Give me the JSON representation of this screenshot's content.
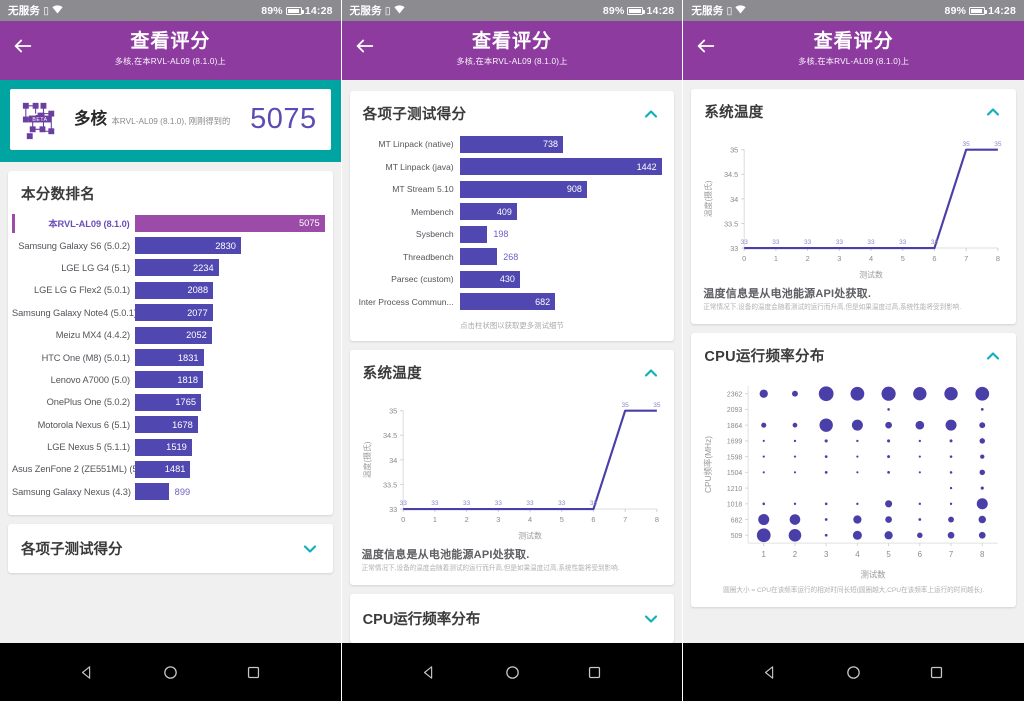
{
  "status_bar": {
    "carrier": "无服务",
    "battery_percent": "89%",
    "time": "14:28",
    "icons": [
      "sim-icon",
      "wifi-icon",
      "battery-icon"
    ]
  },
  "app_bar": {
    "title": "查看评分",
    "subtitle": "多核,在本RVL-AL09 (8.1.0)上",
    "back_icon": "back-arrow-icon"
  },
  "hero": {
    "logo": "geekbench-beta-logo",
    "title": "多核",
    "subtitle": "本RVL-AL09 (8.1.0), 刚刚得到的",
    "score": "5075"
  },
  "sections": {
    "ranking_title": "本分数排名",
    "subtest_title": "各项子测试得分",
    "temperature_title": "系统温度",
    "cpu_freq_title": "CPU运行频率分布",
    "subtest_hint": "点击柱状图以获取更多测试细节",
    "temp_note_main": "温度信息是从电池能源API处获取.",
    "temp_note_sub": "正常情况下,设备的温度会随着测试的运行而升高,但是如果温度过高,系统性能将受到影响.",
    "cpu_note": "圆圈大小 = CPU在该频率运行的相对时间长短(圆圈越大,CPU在该频率上运行的时间越长)."
  },
  "chart_data": [
    {
      "type": "bar",
      "title": "本分数排名",
      "orientation": "horizontal",
      "highlight_index": 0,
      "categories": [
        "本RVL-AL09 (8.1.0)",
        "Samsung Galaxy S6 (5.0.2)",
        "LGE LG G4 (5.1)",
        "LGE LG G Flex2 (5.0.1)",
        "Samsung Galaxy Note4 (5.0.1)",
        "Meizu MX4 (4.4.2)",
        "HTC One (M8) (5.0.1)",
        "Lenovo A7000 (5.0)",
        "OnePlus One (5.0.2)",
        "Motorola Nexus 6 (5.1)",
        "LGE Nexus 5 (5.1.1)",
        "Asus ZenFone 2 (ZE551ML) (5...",
        "Samsung Galaxy Nexus (4.3)"
      ],
      "values": [
        5075,
        2830,
        2234,
        2088,
        2077,
        2052,
        1831,
        1818,
        1765,
        1678,
        1519,
        1481,
        899
      ],
      "xlabel": "",
      "ylabel": "",
      "xlim": [
        0,
        5075
      ]
    },
    {
      "type": "bar",
      "title": "各项子测试得分",
      "orientation": "horizontal",
      "categories": [
        "MT Linpack (native)",
        "MT Linpack (java)",
        "MT Stream 5.10",
        "Membench",
        "Sysbench",
        "Threadbench",
        "Parsec (custom)",
        "Inter Process Commun..."
      ],
      "values": [
        738,
        1442,
        908,
        409,
        198,
        268,
        430,
        682
      ],
      "xlabel": "",
      "ylabel": "",
      "xlim": [
        0,
        1442
      ]
    },
    {
      "type": "line",
      "title": "系统温度",
      "x": [
        0,
        1,
        2,
        3,
        4,
        5,
        6,
        7,
        8
      ],
      "values": [
        33,
        33,
        33,
        33,
        33,
        33,
        33,
        35,
        35
      ],
      "point_labels": [
        "33",
        "33",
        "33",
        "33",
        "33",
        "33",
        "33",
        "35",
        "35"
      ],
      "xlabel": "测试数",
      "ylabel": "温度(摄氏)",
      "ytick_labels": [
        "33",
        "33.5",
        "34",
        "34.5",
        "35"
      ],
      "xtick_labels": [
        "0",
        "1",
        "2",
        "3",
        "4",
        "5",
        "6",
        "7",
        "8"
      ],
      "ylim": [
        33,
        35
      ],
      "xlim": [
        0,
        8
      ],
      "grid": false,
      "legend": "none",
      "line_color": "#4a3fa8"
    },
    {
      "type": "scatter",
      "title": "CPU运行频率分布",
      "xlabel": "测试数",
      "ylabel": "CPU频率(MHz)",
      "xtick_labels": [
        "1",
        "2",
        "3",
        "4",
        "5",
        "6",
        "7",
        "8"
      ],
      "ytick_labels": [
        "2362",
        "2093",
        "1864",
        "1699",
        "1598",
        "1504",
        "1210",
        "1018",
        "682",
        "509"
      ],
      "bubble_color": "#4a3fa8",
      "points": [
        {
          "x": 1,
          "y": "2362",
          "r": 4.2
        },
        {
          "x": 2,
          "y": "2362",
          "r": 3.0
        },
        {
          "x": 3,
          "y": "2362",
          "r": 7.5
        },
        {
          "x": 4,
          "y": "2362",
          "r": 7.0
        },
        {
          "x": 5,
          "y": "2362",
          "r": 7.2
        },
        {
          "x": 6,
          "y": "2362",
          "r": 6.8
        },
        {
          "x": 7,
          "y": "2362",
          "r": 6.8
        },
        {
          "x": 8,
          "y": "2362",
          "r": 7.0
        },
        {
          "x": 5,
          "y": "2093",
          "r": 1.3
        },
        {
          "x": 8,
          "y": "2093",
          "r": 1.4
        },
        {
          "x": 1,
          "y": "1864",
          "r": 2.6
        },
        {
          "x": 2,
          "y": "1864",
          "r": 2.4
        },
        {
          "x": 3,
          "y": "1864",
          "r": 6.8
        },
        {
          "x": 4,
          "y": "1864",
          "r": 5.6
        },
        {
          "x": 5,
          "y": "1864",
          "r": 3.4
        },
        {
          "x": 6,
          "y": "1864",
          "r": 4.4
        },
        {
          "x": 7,
          "y": "1864",
          "r": 5.6
        },
        {
          "x": 8,
          "y": "1864",
          "r": 3.0
        },
        {
          "x": 1,
          "y": "1699",
          "r": 1.1
        },
        {
          "x": 2,
          "y": "1699",
          "r": 1.2
        },
        {
          "x": 3,
          "y": "1699",
          "r": 1.6
        },
        {
          "x": 4,
          "y": "1699",
          "r": 1.2
        },
        {
          "x": 5,
          "y": "1699",
          "r": 1.6
        },
        {
          "x": 6,
          "y": "1699",
          "r": 1.2
        },
        {
          "x": 7,
          "y": "1699",
          "r": 1.5
        },
        {
          "x": 8,
          "y": "1699",
          "r": 2.8
        },
        {
          "x": 1,
          "y": "1598",
          "r": 1.1
        },
        {
          "x": 2,
          "y": "1598",
          "r": 1.1
        },
        {
          "x": 3,
          "y": "1598",
          "r": 1.4
        },
        {
          "x": 4,
          "y": "1598",
          "r": 1.1
        },
        {
          "x": 5,
          "y": "1598",
          "r": 1.5
        },
        {
          "x": 6,
          "y": "1598",
          "r": 1.1
        },
        {
          "x": 7,
          "y": "1598",
          "r": 1.3
        },
        {
          "x": 8,
          "y": "1598",
          "r": 2.2
        },
        {
          "x": 1,
          "y": "1504",
          "r": 1.1
        },
        {
          "x": 2,
          "y": "1504",
          "r": 1.1
        },
        {
          "x": 3,
          "y": "1504",
          "r": 1.4
        },
        {
          "x": 4,
          "y": "1504",
          "r": 1.1
        },
        {
          "x": 5,
          "y": "1504",
          "r": 1.4
        },
        {
          "x": 6,
          "y": "1504",
          "r": 1.1
        },
        {
          "x": 7,
          "y": "1504",
          "r": 1.3
        },
        {
          "x": 8,
          "y": "1504",
          "r": 2.8
        },
        {
          "x": 7,
          "y": "1210",
          "r": 1.2
        },
        {
          "x": 8,
          "y": "1210",
          "r": 1.6
        },
        {
          "x": 1,
          "y": "1018",
          "r": 1.3
        },
        {
          "x": 2,
          "y": "1018",
          "r": 1.2
        },
        {
          "x": 3,
          "y": "1018",
          "r": 1.3
        },
        {
          "x": 4,
          "y": "1018",
          "r": 1.2
        },
        {
          "x": 5,
          "y": "1018",
          "r": 3.6
        },
        {
          "x": 6,
          "y": "1018",
          "r": 1.2
        },
        {
          "x": 7,
          "y": "1018",
          "r": 1.2
        },
        {
          "x": 8,
          "y": "1018",
          "r": 5.6
        },
        {
          "x": 1,
          "y": "682",
          "r": 5.6
        },
        {
          "x": 2,
          "y": "682",
          "r": 5.4
        },
        {
          "x": 3,
          "y": "682",
          "r": 1.4
        },
        {
          "x": 4,
          "y": "682",
          "r": 4.2
        },
        {
          "x": 5,
          "y": "682",
          "r": 3.4
        },
        {
          "x": 6,
          "y": "682",
          "r": 1.4
        },
        {
          "x": 7,
          "y": "682",
          "r": 3.0
        },
        {
          "x": 8,
          "y": "682",
          "r": 3.8
        },
        {
          "x": 1,
          "y": "509",
          "r": 7.0
        },
        {
          "x": 2,
          "y": "509",
          "r": 6.4
        },
        {
          "x": 3,
          "y": "509",
          "r": 1.4
        },
        {
          "x": 4,
          "y": "509",
          "r": 4.6
        },
        {
          "x": 5,
          "y": "509",
          "r": 4.2
        },
        {
          "x": 6,
          "y": "509",
          "r": 2.8
        },
        {
          "x": 7,
          "y": "509",
          "r": 3.4
        },
        {
          "x": 8,
          "y": "509",
          "r": 3.4
        }
      ]
    }
  ],
  "nav_bar": {
    "back_icon": "nav-back-triangle-icon",
    "home_icon": "nav-home-circle-icon",
    "recents_icon": "nav-recents-square-icon"
  },
  "colors": {
    "appbar_purple": "#8e3ba0",
    "hero_teal": "#00a4a0",
    "bar_blue": "#5147b0",
    "bar_highlight": "#9c4ca8",
    "score_purple": "#5b4bb5",
    "chevron_teal": "#12b0bd"
  }
}
